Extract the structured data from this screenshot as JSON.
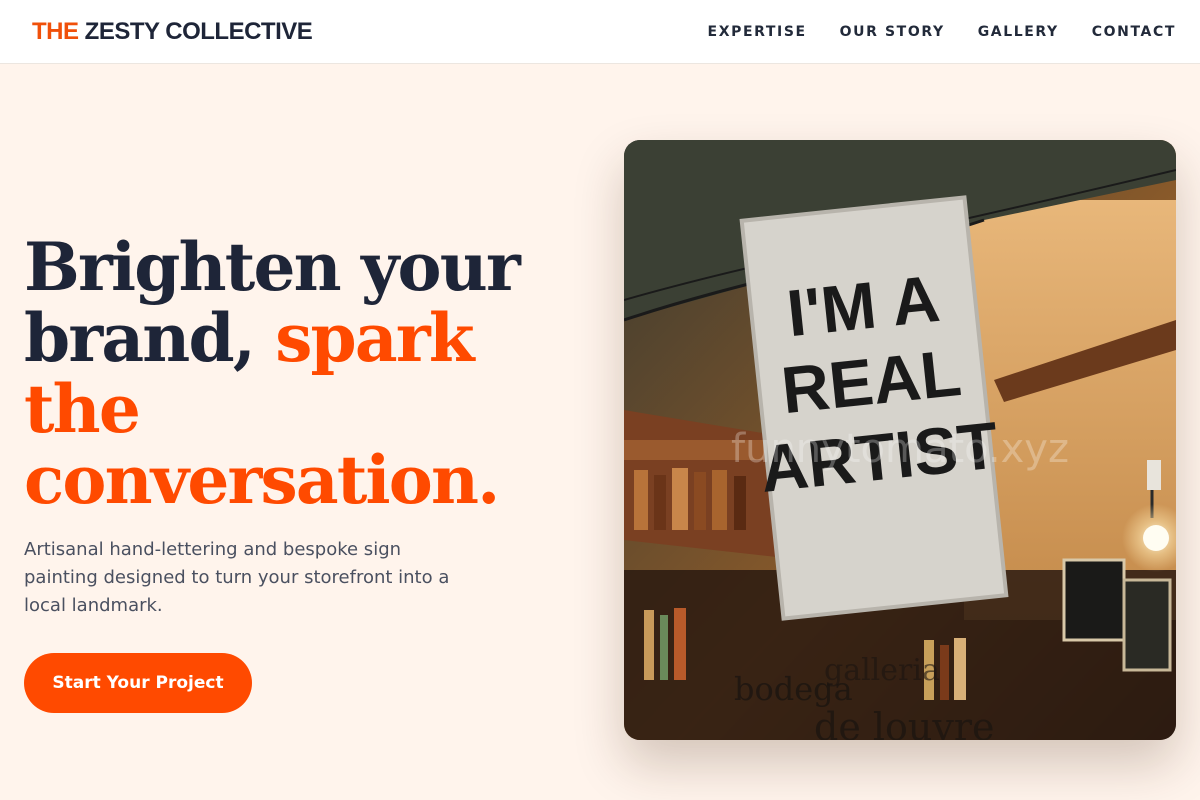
{
  "header": {
    "logo_accent": "THE",
    "logo_rest": "ZESTY COLLECTIVE",
    "nav": [
      "EXPERTISE",
      "OUR STORY",
      "GALLERY",
      "CONTACT"
    ]
  },
  "hero": {
    "headline_line1": "Brighten your",
    "headline_line2_dark": "brand,",
    "headline_line2_orange": "spark the",
    "headline_line3_orange": "conversation.",
    "subtext": "Artisanal hand-lettering and bespoke sign painting designed to turn your storefront into a local landmark.",
    "cta_label": "Start Your Project"
  },
  "image": {
    "sign_line1": "I'M A",
    "sign_line2": "REAL",
    "sign_line3": "ARTIST",
    "watermark": "funnytomato.xyz",
    "window_lettering": [
      "bodega",
      "galleria",
      "de louvre"
    ]
  },
  "colors": {
    "accent": "#ff4a00",
    "navy": "#1e2538",
    "background": "#fff4ec"
  }
}
